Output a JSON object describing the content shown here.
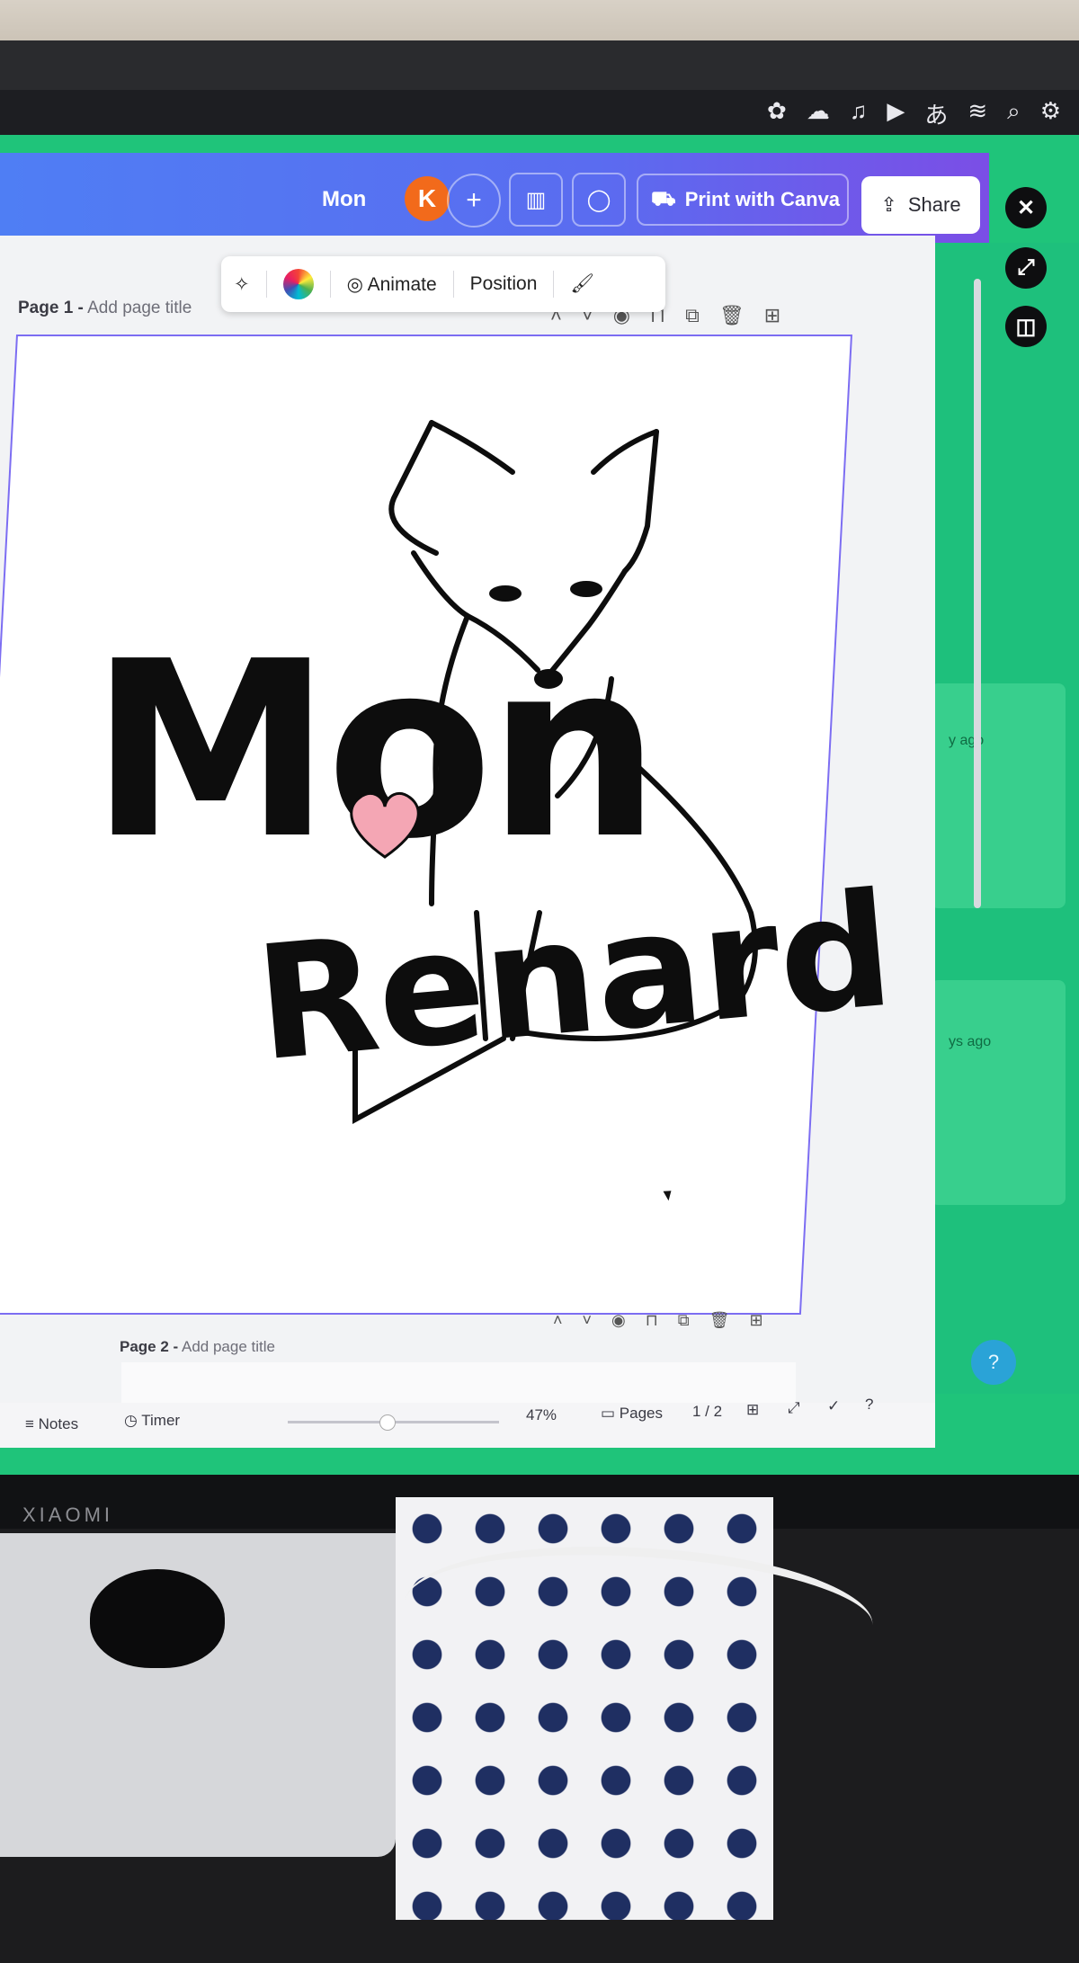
{
  "document": {
    "title": "Mon"
  },
  "collaborator": {
    "initial": "K"
  },
  "topbar": {
    "add_label": "+",
    "print_label": "Print with Canva",
    "share_label": "Share"
  },
  "context_toolbar": {
    "animate_label": "Animate",
    "position_label": "Position"
  },
  "pages": {
    "page1": {
      "prefix": "Page 1 -",
      "placeholder": "Add page title"
    },
    "page2": {
      "prefix": "Page 2 -",
      "placeholder": "Add page title"
    }
  },
  "design": {
    "word1": "Mon",
    "word2": "Renard",
    "heart_color": "#f4a6b4"
  },
  "bottombar": {
    "notes_label": "Notes",
    "timer_label": "Timer",
    "zoom": "47%",
    "pages_label": "Pages",
    "page_count": "1 / 2",
    "zoom_fraction": 0.47
  },
  "side_panel": {
    "time_1": "y ago",
    "time_2": "ys ago"
  },
  "help_label": "?",
  "hardware": {
    "brand": "XIAOMI"
  },
  "colors": {
    "brand_gradient_start": "#4f7ef4",
    "brand_gradient_end": "#7b4ee6",
    "screen_bg": "#1fc47a",
    "selection": "#7c6df2"
  },
  "icons": [
    "sparkle-comment-icon",
    "color-wheel-icon",
    "animate-icon",
    "paint-roller-icon",
    "chevron-up-icon",
    "chevron-down-icon",
    "hide-icon",
    "lock-icon",
    "duplicate-icon",
    "trash-icon",
    "add-page-icon",
    "chart-icon",
    "comment-icon",
    "truck-icon",
    "share-icon",
    "close-icon",
    "expand-icon",
    "panel-icon",
    "notes-icon",
    "timer-icon",
    "pages-icon",
    "grid-icon",
    "fullscreen-icon",
    "check-icon",
    "help-icon"
  ]
}
